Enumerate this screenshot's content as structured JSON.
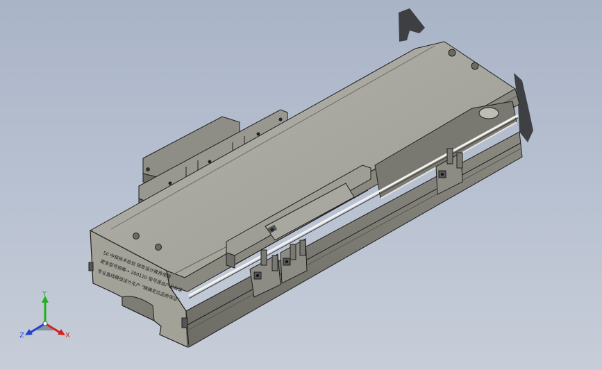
{
  "viewport": {
    "background": "#b4bece",
    "model": {
      "body_color": "#8c8b83",
      "top_color": "#a7a69e",
      "edge_color": "#1e1e1e",
      "end_plate_color": "#9e9d93",
      "end_plate_text": [
        "50 中核技术检验  研发设计推荐使用",
        "更多型号规格→ 200120 型号源自产品目录",
        "专业直线模组设计生产  \"精确定位品质保证\""
      ]
    },
    "triad": {
      "x_label": "X",
      "y_label": "Y",
      "z_label": "Z",
      "x_color": "#d22020",
      "y_color": "#20b020",
      "z_color": "#2040d0"
    }
  }
}
